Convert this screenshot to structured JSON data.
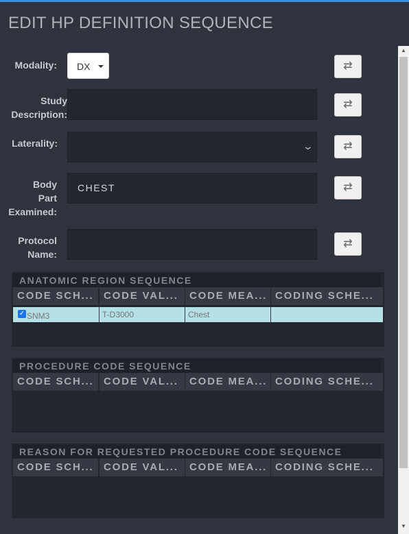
{
  "title": "EDIT HP DEFINITION SEQUENCE",
  "fields": {
    "modality": {
      "label": "Modality:",
      "value": "DX"
    },
    "study_description": {
      "label_lines": [
        "Study",
        "Description:"
      ],
      "value": ""
    },
    "laterality": {
      "label": "Laterality:",
      "value": ""
    },
    "body_part": {
      "label_lines": [
        "Body",
        "Part",
        "Examined:"
      ],
      "value": "CHEST"
    },
    "protocol_name": {
      "label_lines": [
        "Protocol",
        "Name:"
      ],
      "value": ""
    }
  },
  "swap_icon": "⇄",
  "columns": [
    "CODE SCH...",
    "CODE VAL...",
    "CODE MEA...",
    "CODING SCHE..."
  ],
  "sections": {
    "anatomic": {
      "title": "ANATOMIC REGION SEQUENCE",
      "rows": [
        {
          "checked": true,
          "scheme": "SNM3",
          "value": "T-D3000",
          "meaning": "Chest",
          "coding": ""
        }
      ]
    },
    "procedure": {
      "title": "PROCEDURE CODE SEQUENCE"
    },
    "reason": {
      "title": "REASON FOR REQUESTED PROCEDURE CODE SEQUENCE"
    }
  },
  "colors": {
    "accent": "#3b8fd8",
    "row_highlight": "#b4e0e6",
    "background": "#2f333d"
  }
}
